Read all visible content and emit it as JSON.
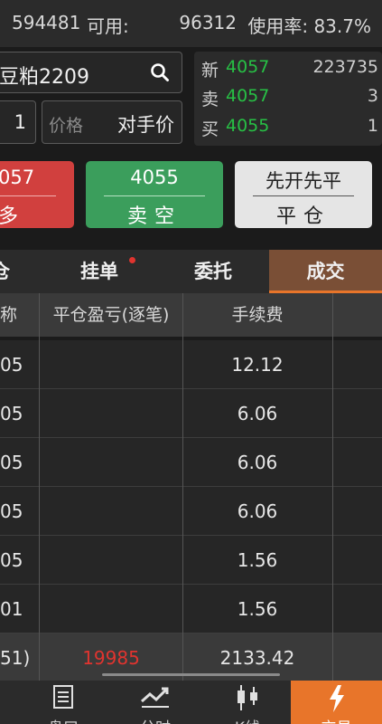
{
  "account": {
    "balance": "594481",
    "available_label": "可用:",
    "available_value": "96312",
    "usage_rate": "使用率: 83.7%"
  },
  "order": {
    "instrument": "豆粕2209",
    "quantity": "1",
    "price_label": "价格",
    "price_mode": "对手价"
  },
  "quote": [
    {
      "label": "新",
      "price": "4057",
      "volume": "223735"
    },
    {
      "label": "卖",
      "price": "4057",
      "volume": "3"
    },
    {
      "label": "买",
      "price": "4055",
      "volume": "1"
    }
  ],
  "buttons": {
    "buy_price": "057",
    "buy_action": "多",
    "sell_price": "4055",
    "sell_action": "卖空",
    "close_label": "先开先平",
    "close_action": "平仓"
  },
  "tabs": [
    "仓",
    "挂单",
    "委托",
    "成交"
  ],
  "active_tab": "成交",
  "table": {
    "headers": [
      "称",
      "平仓盈亏(逐笔)",
      "手续费"
    ],
    "rows": [
      {
        "name": "05",
        "pnl": "",
        "fee": "12.12"
      },
      {
        "name": "05",
        "pnl": "",
        "fee": "6.06"
      },
      {
        "name": "05",
        "pnl": "",
        "fee": "6.06"
      },
      {
        "name": "05",
        "pnl": "",
        "fee": "6.06"
      },
      {
        "name": "05",
        "pnl": "",
        "fee": "1.56"
      },
      {
        "name": "01",
        "pnl": "",
        "fee": "1.56"
      }
    ],
    "summary": {
      "name": "51)",
      "pnl": "19985",
      "fee": "2133.42"
    }
  },
  "nav": [
    {
      "label": "盘口",
      "icon": "orderbook-icon"
    },
    {
      "label": "分时",
      "icon": "trend-icon"
    },
    {
      "label": "K线",
      "icon": "candlestick-icon"
    },
    {
      "label": "交易",
      "icon": "lightning-icon"
    }
  ],
  "colors": {
    "up": "#d1403e",
    "down": "#3b9e5c",
    "green_text": "#27c045",
    "accent": "#e8752a"
  }
}
